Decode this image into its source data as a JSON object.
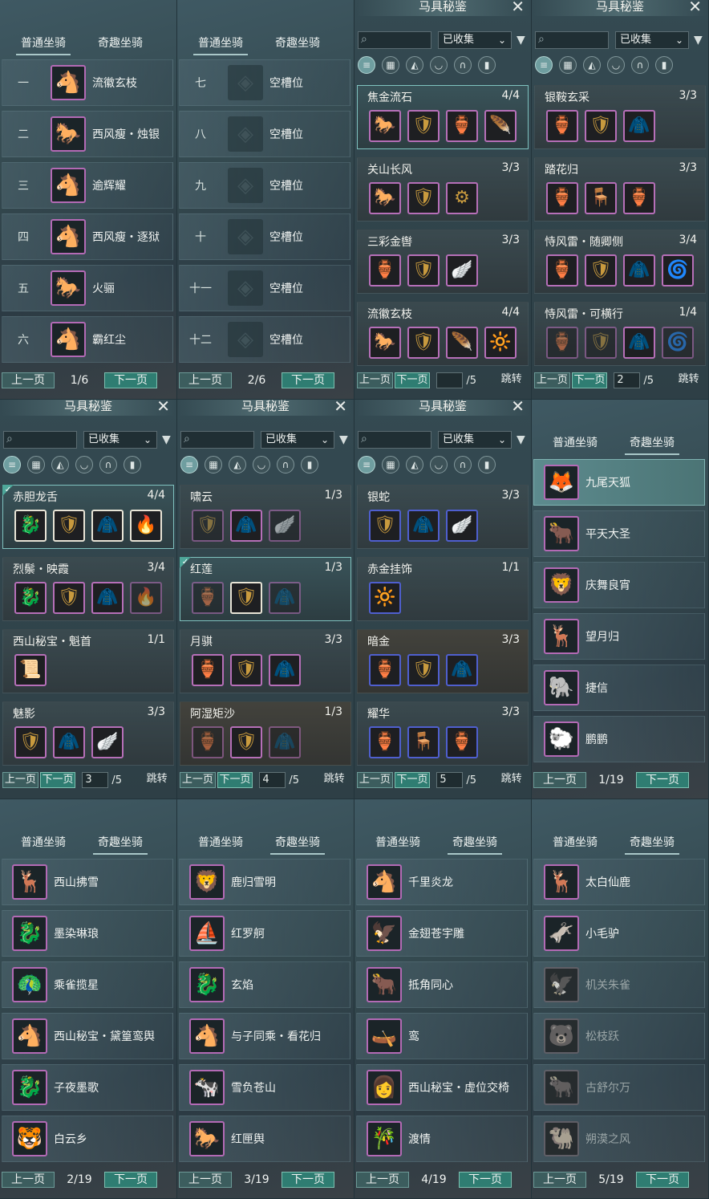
{
  "mount_common": {
    "tab_normal": "普通坐骑",
    "tab_fun": "奇趣坐骑",
    "prev": "上一页",
    "next": "下一页"
  },
  "coll_common": {
    "title": "马具秘鉴",
    "filter": "已收集",
    "prev": "上一页",
    "next": "下一页",
    "jump": "跳转",
    "page_total": "/5"
  },
  "icons": {
    "close": "close-icon",
    "search": "search-icon",
    "filter": "filter-icon",
    "chevron": "chevron-down-icon"
  },
  "colors": {
    "accent_green": "#2f7d72",
    "purple_frame": "#b66fb8",
    "blue_frame": "#4f5fcf",
    "highlight": "#7fc2bf"
  },
  "mount_pages": [
    {
      "page": "1/6",
      "active_tab": 0,
      "rows": [
        {
          "num": "一",
          "name": "流徽玄枝",
          "icon": "🐴"
        },
        {
          "num": "二",
          "name": "西风瘦・烛银",
          "icon": "🐎"
        },
        {
          "num": "三",
          "name": "逾辉耀",
          "icon": "🐴"
        },
        {
          "num": "四",
          "name": "西风瘦・逐狱",
          "icon": "🐴"
        },
        {
          "num": "五",
          "name": "火骊",
          "icon": "🐎"
        },
        {
          "num": "六",
          "name": "霸红尘",
          "icon": "🐴"
        }
      ]
    },
    {
      "page": "2/6",
      "active_tab": 0,
      "rows": [
        {
          "num": "七",
          "name": "空槽位",
          "empty": true
        },
        {
          "num": "八",
          "name": "空槽位",
          "empty": true
        },
        {
          "num": "九",
          "name": "空槽位",
          "empty": true
        },
        {
          "num": "十",
          "name": "空槽位",
          "empty": true
        },
        {
          "num": "十一",
          "name": "空槽位",
          "empty": true
        },
        {
          "num": "十二",
          "name": "空槽位",
          "empty": true
        }
      ]
    },
    {
      "page": "1/19",
      "active_tab": 1,
      "rows": [
        {
          "name": "九尾天狐",
          "icon": "🦊",
          "sel": true
        },
        {
          "name": "平天大圣",
          "icon": "🐂"
        },
        {
          "name": "庆舞良宵",
          "icon": "🦁"
        },
        {
          "name": "望月归",
          "icon": "🦌"
        },
        {
          "name": "捷信",
          "icon": "🐘"
        },
        {
          "name": "鹏鹏",
          "icon": "🐑"
        }
      ]
    },
    {
      "page": "2/19",
      "active_tab": 1,
      "rows": [
        {
          "name": "西山拂雪",
          "icon": "🦌"
        },
        {
          "name": "墨染琳琅",
          "icon": "🐉"
        },
        {
          "name": "乘雀揽星",
          "icon": "🦚"
        },
        {
          "name": "西山秘宝・黛篁鸾舆",
          "icon": "🐴"
        },
        {
          "name": "子夜墨歌",
          "icon": "🐉"
        },
        {
          "name": "白云乡",
          "icon": "🐯"
        }
      ]
    },
    {
      "page": "3/19",
      "active_tab": 1,
      "rows": [
        {
          "name": "鹿归雪明",
          "icon": "🦁"
        },
        {
          "name": "红罗舸",
          "icon": "⛵"
        },
        {
          "name": "玄焰",
          "icon": "🐉"
        },
        {
          "name": "与子同乘・看花归",
          "icon": "🐴"
        },
        {
          "name": "雪负苍山",
          "icon": "🐄"
        },
        {
          "name": "红匣舆",
          "icon": "🐎"
        }
      ]
    },
    {
      "page": "4/19",
      "active_tab": 1,
      "rows": [
        {
          "name": "千里炎龙",
          "icon": "🐴"
        },
        {
          "name": "金翅苍宇雕",
          "icon": "🦅"
        },
        {
          "name": "抵角同心",
          "icon": "🐂"
        },
        {
          "name": "鸾",
          "icon": "🛶"
        },
        {
          "name": "西山秘宝・虚位交椅",
          "icon": "👩"
        },
        {
          "name": "渡情",
          "icon": "🎋"
        }
      ]
    },
    {
      "page": "5/19",
      "active_tab": 1,
      "rows": [
        {
          "name": "太白仙鹿",
          "icon": "🦌"
        },
        {
          "name": "小毛驴",
          "icon": "🫏"
        },
        {
          "name": "机关朱雀",
          "icon": "🦅",
          "dim": true
        },
        {
          "name": "松枝跃",
          "icon": "🐻",
          "dim": true
        },
        {
          "name": "古舒尔万",
          "icon": "🐂",
          "dim": true
        },
        {
          "name": "朔漠之风",
          "icon": "🐫",
          "dim": true
        }
      ]
    }
  ],
  "coll_pages": [
    {
      "page_value": "",
      "sets": [
        {
          "title": "焦金流石",
          "count": "4/4",
          "hl": true,
          "items": [
            [
              "🐎",
              "p"
            ],
            [
              "🛡",
              "p"
            ],
            [
              "🏺",
              "p"
            ],
            [
              "🪶",
              "p"
            ]
          ]
        },
        {
          "title": "关山长风",
          "count": "3/3",
          "items": [
            [
              "🐎",
              "p"
            ],
            [
              "🛡",
              "p"
            ],
            [
              "⚙",
              "p"
            ]
          ]
        },
        {
          "title": "三彩金辔",
          "count": "3/3",
          "items": [
            [
              "🏺",
              "p"
            ],
            [
              "🛡",
              "p"
            ],
            [
              "🪽",
              "p"
            ]
          ]
        },
        {
          "title": "流徽玄枝",
          "count": "4/4",
          "items": [
            [
              "🐎",
              "p"
            ],
            [
              "🛡",
              "p"
            ],
            [
              "🪶",
              "p"
            ],
            [
              "🔆",
              "p"
            ]
          ]
        }
      ]
    },
    {
      "page_value": "2",
      "sets": [
        {
          "title": "银鞍玄采",
          "count": "3/3",
          "items": [
            [
              "🏺",
              "p"
            ],
            [
              "🛡",
              "p"
            ],
            [
              "🧥",
              "p"
            ]
          ]
        },
        {
          "title": "踏花归",
          "count": "3/3",
          "items": [
            [
              "🏺",
              "p"
            ],
            [
              "🪑",
              "p"
            ],
            [
              "🏺",
              "p"
            ]
          ]
        },
        {
          "title": "恃风雷・随卿侧",
          "count": "3/4",
          "items": [
            [
              "🏺",
              "p"
            ],
            [
              "🛡",
              "p"
            ],
            [
              "🧥",
              "p"
            ],
            [
              "🌀",
              "p"
            ]
          ]
        },
        {
          "title": "恃风雷・可横行",
          "count": "1/4",
          "items": [
            [
              "🏺",
              "pm"
            ],
            [
              "🛡",
              "pm"
            ],
            [
              "🧥",
              "p"
            ],
            [
              "🌀",
              "pm"
            ]
          ]
        }
      ]
    },
    {
      "page_value": "3",
      "sets": [
        {
          "title": "赤胆龙舌",
          "count": "4/4",
          "hl": true,
          "check": true,
          "items": [
            [
              "🐉",
              "w"
            ],
            [
              "🛡",
              "w"
            ],
            [
              "🧥",
              "w"
            ],
            [
              "🔥",
              "w"
            ]
          ]
        },
        {
          "title": "烈鬃・映霞",
          "count": "3/4",
          "items": [
            [
              "🐉",
              "p"
            ],
            [
              "🛡",
              "p"
            ],
            [
              "🧥",
              "p"
            ],
            [
              "🔥",
              "pm"
            ]
          ]
        },
        {
          "title": "西山秘宝・魁首",
          "count": "1/1",
          "items": [
            [
              "📜",
              "p"
            ]
          ]
        },
        {
          "title": "魅影",
          "count": "3/3",
          "items": [
            [
              "🛡",
              "p"
            ],
            [
              "🧥",
              "p"
            ],
            [
              "🪽",
              "p"
            ]
          ]
        }
      ]
    },
    {
      "page_value": "4",
      "sets": [
        {
          "title": "啸云",
          "count": "1/3",
          "items": [
            [
              "🛡",
              "pm"
            ],
            [
              "🧥",
              "p"
            ],
            [
              "🪽",
              "pm"
            ]
          ]
        },
        {
          "title": "红莲",
          "count": "1/3",
          "hl": true,
          "check": true,
          "items": [
            [
              "🏺",
              "pm"
            ],
            [
              "🛡",
              "w"
            ],
            [
              "🧥",
              "pm"
            ]
          ]
        },
        {
          "title": "月骐",
          "count": "3/3",
          "items": [
            [
              "🏺",
              "p"
            ],
            [
              "🛡",
              "p"
            ],
            [
              "🧥",
              "p"
            ]
          ]
        },
        {
          "title": "阿湿矩沙",
          "count": "1/3",
          "gold": true,
          "items": [
            [
              "🏺",
              "pm"
            ],
            [
              "🛡",
              "p"
            ],
            [
              "🧥",
              "pm"
            ]
          ]
        }
      ]
    },
    {
      "page_value": "5",
      "sets": [
        {
          "title": "银蛇",
          "count": "3/3",
          "items": [
            [
              "🛡",
              "b"
            ],
            [
              "🧥",
              "b"
            ],
            [
              "🪽",
              "b"
            ]
          ]
        },
        {
          "title": "赤金挂饰",
          "count": "1/1",
          "items": [
            [
              "🔆",
              "b"
            ]
          ]
        },
        {
          "title": "暗金",
          "count": "3/3",
          "gold": true,
          "items": [
            [
              "🏺",
              "b"
            ],
            [
              "🛡",
              "b"
            ],
            [
              "🧥",
              "b"
            ]
          ]
        },
        {
          "title": "耀华",
          "count": "3/3",
          "items": [
            [
              "🏺",
              "b"
            ],
            [
              "🪑",
              "b"
            ],
            [
              "🏺",
              "b"
            ]
          ]
        }
      ]
    }
  ]
}
